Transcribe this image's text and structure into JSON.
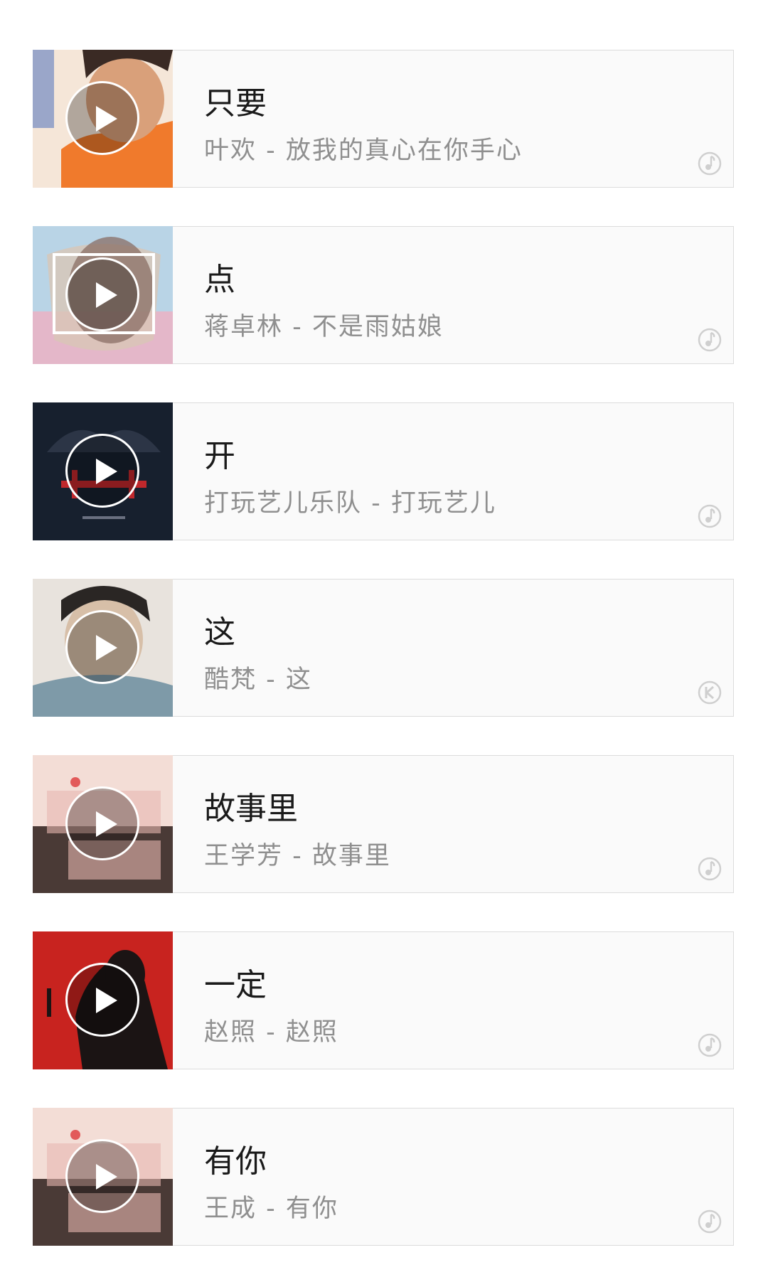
{
  "songs": [
    {
      "title": "只要",
      "subtitle": "叶欢 - 放我的真心在你手心",
      "cover_icon": "portrait-orange-icon",
      "play_icon": "play-icon",
      "source_icon": "music-note-icon",
      "colors": {
        "bg": "#f07a2c",
        "accent": "#3a2a24",
        "sky": "#f5e6d8"
      }
    },
    {
      "title": "点",
      "subtitle": "蒋卓林 - 不是雨姑娘",
      "cover_icon": "abstract-pastel-icon",
      "play_icon": "play-icon",
      "source_icon": "music-note-icon",
      "colors": {
        "bg": "#b9d4e6",
        "accent": "#8a6e64",
        "sky": "#e4b7c9"
      }
    },
    {
      "title": "开",
      "subtitle": "打玩艺儿乐队 - 打玩艺儿",
      "cover_icon": "dark-album-icon",
      "play_icon": "play-icon",
      "source_icon": "music-note-icon",
      "colors": {
        "bg": "#17202e",
        "accent": "#c0282c",
        "sky": "#2c3546"
      }
    },
    {
      "title": "这",
      "subtitle": "酷梵 - 这",
      "cover_icon": "portrait-boy-icon",
      "play_icon": "play-icon",
      "source_icon": "karaoke-k-icon",
      "colors": {
        "bg": "#e8e3dd",
        "accent": "#2a2624",
        "sky": "#7e9aa8"
      }
    },
    {
      "title": "故事里",
      "subtitle": "王学芳 - 故事里",
      "cover_icon": "classic-songs-icon",
      "play_icon": "play-icon",
      "source_icon": "music-note-icon",
      "colors": {
        "bg": "#f3ddd6",
        "accent": "#4a3a36",
        "sky": "#e25a5a"
      }
    },
    {
      "title": "一定",
      "subtitle": "赵照 - 赵照",
      "cover_icon": "silhouette-red-icon",
      "play_icon": "play-icon",
      "source_icon": "music-note-icon",
      "colors": {
        "bg": "#c8231f",
        "accent": "#1b1414",
        "sky": "#a81d1a"
      }
    },
    {
      "title": "有你",
      "subtitle": "王成 - 有你",
      "cover_icon": "classic-songs-icon",
      "play_icon": "play-icon",
      "source_icon": "music-note-icon",
      "colors": {
        "bg": "#f3ddd6",
        "accent": "#4a3a36",
        "sky": "#e25a5a"
      }
    }
  ]
}
